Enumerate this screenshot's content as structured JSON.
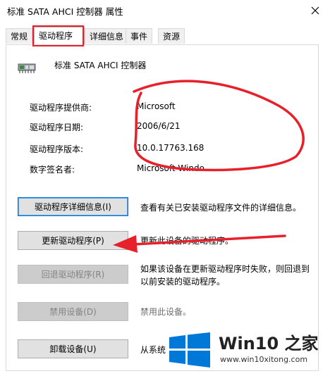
{
  "window": {
    "title": "标准 SATA AHCI 控制器 属性"
  },
  "tabs": [
    {
      "label": "常规"
    },
    {
      "label": "驱动程序"
    },
    {
      "label": "详细信息"
    },
    {
      "label": "事件"
    },
    {
      "label": "资源"
    }
  ],
  "device": {
    "name": "标准 SATA AHCI 控制器"
  },
  "info": {
    "provider_label": "驱动程序提供商:",
    "provider_value": "Microsoft",
    "date_label": "驱动程序日期:",
    "date_value": "2006/6/21",
    "version_label": "驱动程序版本:",
    "version_value": "10.0.17763.168",
    "signer_label": "数字签名者:",
    "signer_value": "Microsoft Windo"
  },
  "actions": {
    "details_button": "驱动程序详细信息(I)",
    "details_desc": "查看有关已安装驱动程序文件的详细信息。",
    "update_button": "更新驱动程序(P)",
    "update_desc": "更新此设备的驱动程序。",
    "rollback_button": "回退驱动程序(R)",
    "rollback_desc": "如果该设备在更新驱动程序时失败，则回退到以前安装的驱动程序。",
    "disable_button": "禁用设备(D)",
    "disable_desc": "禁用此设备。",
    "uninstall_button": "卸载设备(U)",
    "uninstall_desc": "从系统"
  },
  "watermark": {
    "title": "Win10 之家",
    "url": "www.win10xitong.com"
  },
  "colors": {
    "annotation_red": "#e8202a",
    "win_blue": "#0078d7"
  }
}
